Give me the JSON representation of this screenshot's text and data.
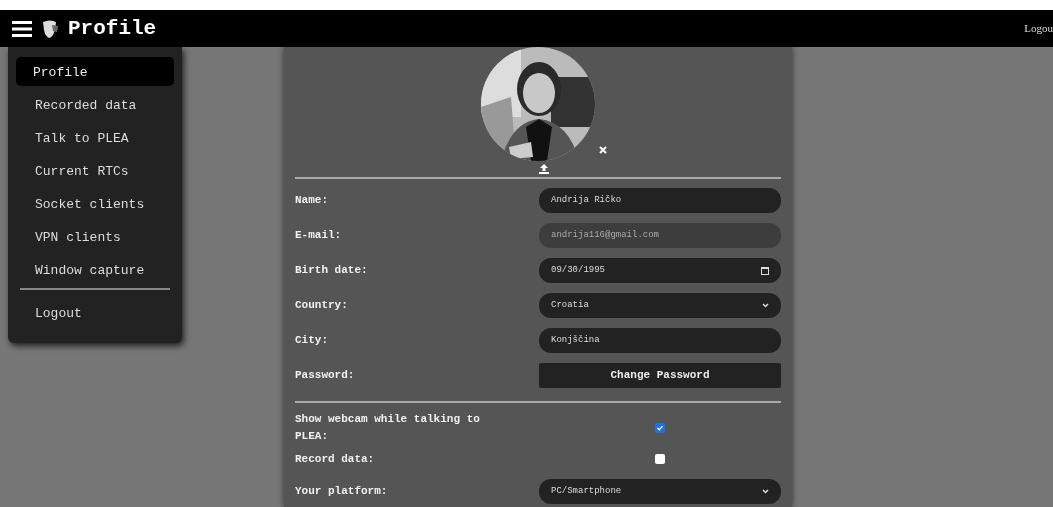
{
  "navbar": {
    "title": "Profile",
    "logout": "Logou"
  },
  "menu": {
    "items": [
      {
        "label": "Profile",
        "selected": true
      },
      {
        "label": "Recorded data",
        "selected": false
      },
      {
        "label": "Talk to PLEA",
        "selected": false
      },
      {
        "label": "Current RTCs",
        "selected": false
      },
      {
        "label": "Socket clients",
        "selected": false
      },
      {
        "label": "VPN clients",
        "selected": false
      },
      {
        "label": "Window capture",
        "selected": false
      }
    ],
    "footer": "Logout"
  },
  "fields": [
    {
      "kind": "text",
      "label": "Name:",
      "value": "Andrija Ričko",
      "disabled": false
    },
    {
      "kind": "text",
      "label": "E-mail:",
      "value": "andrija116@gmail.com",
      "disabled": true
    },
    {
      "kind": "date",
      "label": "Birth date:",
      "value": "09/30/1995",
      "disabled": false
    },
    {
      "kind": "select",
      "label": "Country:",
      "value": "Croatia",
      "disabled": false
    },
    {
      "kind": "text",
      "label": "City:",
      "value": "Konjščina",
      "disabled": false
    },
    {
      "kind": "button",
      "label": "Password:",
      "value": "Change Password",
      "disabled": false
    }
  ],
  "settings": [
    {
      "kind": "checkbox",
      "label": "Show webcam while talking to PLEA:",
      "checked": true
    },
    {
      "kind": "checkbox",
      "label": "Record data:",
      "checked": false
    },
    {
      "kind": "select",
      "label": "Your platform:",
      "value": "PC/Smartphone"
    }
  ]
}
